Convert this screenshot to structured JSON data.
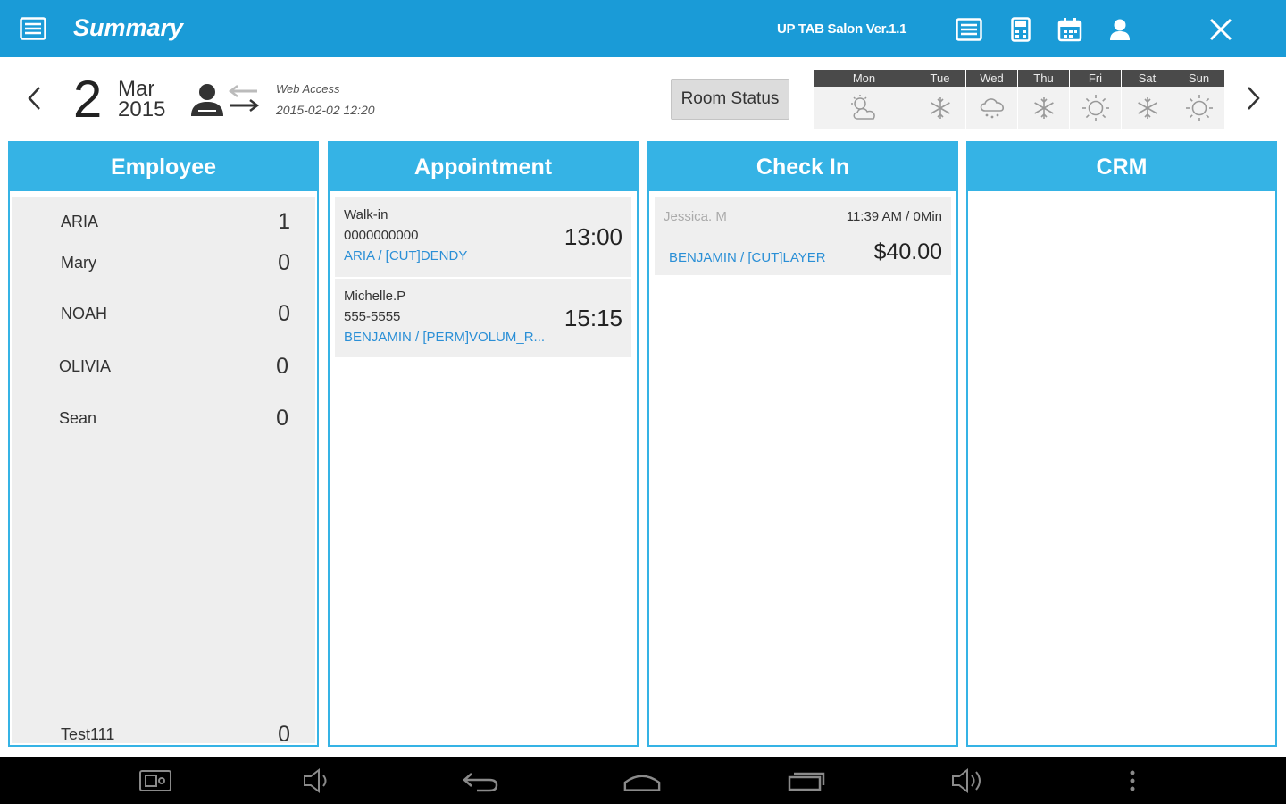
{
  "topbar": {
    "title": "Summary",
    "version": "UP TAB Salon Ver.1.1",
    "icons": [
      "list-icon",
      "calculator-icon",
      "calendar-icon",
      "person-icon",
      "close-icon"
    ],
    "color": "#1a9bd7"
  },
  "date": {
    "day": "2",
    "month": "Mar",
    "year": "2015"
  },
  "web_access": {
    "label": "Web Access",
    "datetime": "2015-02-02 12:20"
  },
  "room_status": {
    "label": "Room Status"
  },
  "weather": [
    {
      "day": "Mon",
      "icon": "cloudy-sun-icon"
    },
    {
      "day": "Tue",
      "icon": "snow-icon"
    },
    {
      "day": "Wed",
      "icon": "snow-cloud-icon"
    },
    {
      "day": "Thu",
      "icon": "snow-icon"
    },
    {
      "day": "Fri",
      "icon": "sun-icon"
    },
    {
      "day": "Sat",
      "icon": "snow-icon"
    },
    {
      "day": "Sun",
      "icon": "sun-icon"
    }
  ],
  "columns": {
    "employee": {
      "title": "Employee"
    },
    "appointment": {
      "title": "Appointment"
    },
    "checkin": {
      "title": "Check In"
    },
    "crm": {
      "title": "CRM"
    },
    "accent": "#35b3e5"
  },
  "employees": [
    {
      "name": "ARIA",
      "count": "1"
    },
    {
      "name": "Mary",
      "count": "0"
    },
    {
      "name": "NOAH",
      "count": "0"
    },
    {
      "name": "OLIVIA",
      "count": "0"
    },
    {
      "name": "Sean",
      "count": "0"
    },
    {
      "name": "Test111",
      "count": "0"
    }
  ],
  "appointments": [
    {
      "client": "Walk-in",
      "phone": "0000000000",
      "service": "ARIA / [CUT]DENDY",
      "time": "13:00"
    },
    {
      "client": "Michelle.P",
      "phone": "555-5555",
      "service": "BENJAMIN / [PERM]VOLUM_R...",
      "time": "15:15"
    }
  ],
  "checkins": [
    {
      "client": "Jessica. M",
      "time": "11:39 AM / 0Min",
      "service": "BENJAMIN / [CUT]LAYER",
      "amount": "$40.00"
    }
  ],
  "navbar": {
    "icons": [
      "screenshot-icon",
      "volume-down-icon",
      "back-icon",
      "home-icon",
      "recent-apps-icon",
      "volume-up-icon",
      "more-icon"
    ]
  }
}
